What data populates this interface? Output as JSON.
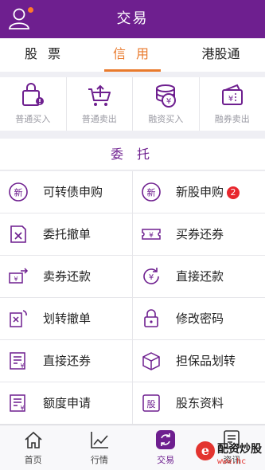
{
  "header": {
    "title": "交易"
  },
  "tabs": [
    {
      "label": "股 票"
    },
    {
      "label": "信 用"
    },
    {
      "label": "港股通"
    }
  ],
  "quick_actions": [
    {
      "label": "普通买入",
      "icon": "bag-buy-icon"
    },
    {
      "label": "普通卖出",
      "icon": "cart-sell-icon"
    },
    {
      "label": "融资买入",
      "icon": "coin-stack-icon"
    },
    {
      "label": "融券卖出",
      "icon": "voucher-icon"
    }
  ],
  "section": {
    "title": "委 托"
  },
  "grid": [
    {
      "label": "可转债申购",
      "icon": "new-circle-icon"
    },
    {
      "label": "新股申购",
      "icon": "new-circle-icon",
      "badge": "2"
    },
    {
      "label": "委托撤单",
      "icon": "cancel-order-icon"
    },
    {
      "label": "买券还券",
      "icon": "ticket-icon"
    },
    {
      "label": "卖券还款",
      "icon": "ticket-money-icon"
    },
    {
      "label": "直接还款",
      "icon": "yen-refresh-icon"
    },
    {
      "label": "划转撤单",
      "icon": "transfer-cancel-icon"
    },
    {
      "label": "修改密码",
      "icon": "lock-icon"
    },
    {
      "label": "直接还券",
      "icon": "document-yen-icon"
    },
    {
      "label": "担保品划转",
      "icon": "box-icon"
    },
    {
      "label": "额度申请",
      "icon": "document-yen-icon"
    },
    {
      "label": "股东资料",
      "icon": "stock-badge-icon"
    }
  ],
  "nav": [
    {
      "label": "首页",
      "icon": "home-icon"
    },
    {
      "label": "行情",
      "icon": "chart-line-icon"
    },
    {
      "label": "交易",
      "icon": "trade-icon"
    },
    {
      "label": "资讯",
      "icon": "news-icon"
    }
  ],
  "watermark": {
    "name": "配资炒股",
    "url": "www.hc"
  },
  "colors": {
    "primary": "#6e1f8f",
    "accent": "#e97a2c",
    "badge": "#e8262d"
  }
}
